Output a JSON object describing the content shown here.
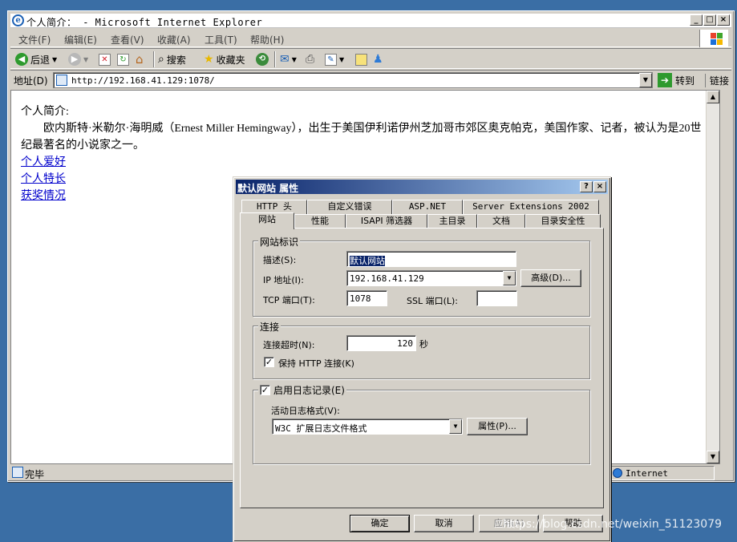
{
  "window": {
    "title": "个人简介： - Microsoft Internet Explorer",
    "controls": [
      "_",
      "□",
      "×"
    ]
  },
  "menu": [
    "文件(F)",
    "编辑(E)",
    "查看(V)",
    "收藏(A)",
    "工具(T)",
    "帮助(H)"
  ],
  "toolbar": {
    "back": "后退",
    "search": "搜索",
    "favorites": "收藏夹"
  },
  "address": {
    "label": "地址(D)",
    "url": "http://192.168.41.129:1078/",
    "go": "转到",
    "links": "链接"
  },
  "page": {
    "heading": "个人简介:",
    "paragraph": "欧内斯特·米勒尔·海明威（Ernest Miller Hemingway），出生于美国伊利诺伊州芝加哥市郊区奥克帕克，美国作家、记者，被认为是20世纪最著名的小说家之一。",
    "links": [
      "个人爱好",
      "个人特长",
      "获奖情况"
    ]
  },
  "status": {
    "text": "完毕",
    "zone": "Internet"
  },
  "dialog": {
    "title": "默认网站 属性",
    "help_btn": "?",
    "close_btn": "×",
    "tabs_back": [
      "HTTP 头",
      "自定义错误",
      "ASP.NET",
      "Server Extensions 2002"
    ],
    "tabs_front": [
      "网站",
      "性能",
      "ISAPI 筛选器",
      "主目录",
      "文档",
      "目录安全性"
    ],
    "site_id": {
      "group": "网站标识",
      "desc_label": "描述(S):",
      "desc_value": "默认网站",
      "ip_label": "IP 地址(I):",
      "ip_value": "192.168.41.129",
      "advanced": "高级(D)...",
      "tcp_label": "TCP 端口(T):",
      "tcp_value": "1078",
      "ssl_label": "SSL 端口(L):",
      "ssl_value": ""
    },
    "connection": {
      "group": "连接",
      "timeout_label": "连接超时(N):",
      "timeout_value": "120",
      "seconds": "秒",
      "keepalive_label": "保持 HTTP 连接(K)",
      "keepalive_checked": true
    },
    "logging": {
      "enable_label": "启用日志记录(E)",
      "enable_checked": true,
      "format_label": "活动日志格式(V):",
      "format_value": "W3C 扩展日志文件格式",
      "properties": "属性(P)..."
    },
    "buttons": {
      "ok": "确定",
      "cancel": "取消",
      "apply": "应用(A)",
      "help": "帮助"
    }
  },
  "watermark": "https://blog.csdn.net/weixin_51123079"
}
